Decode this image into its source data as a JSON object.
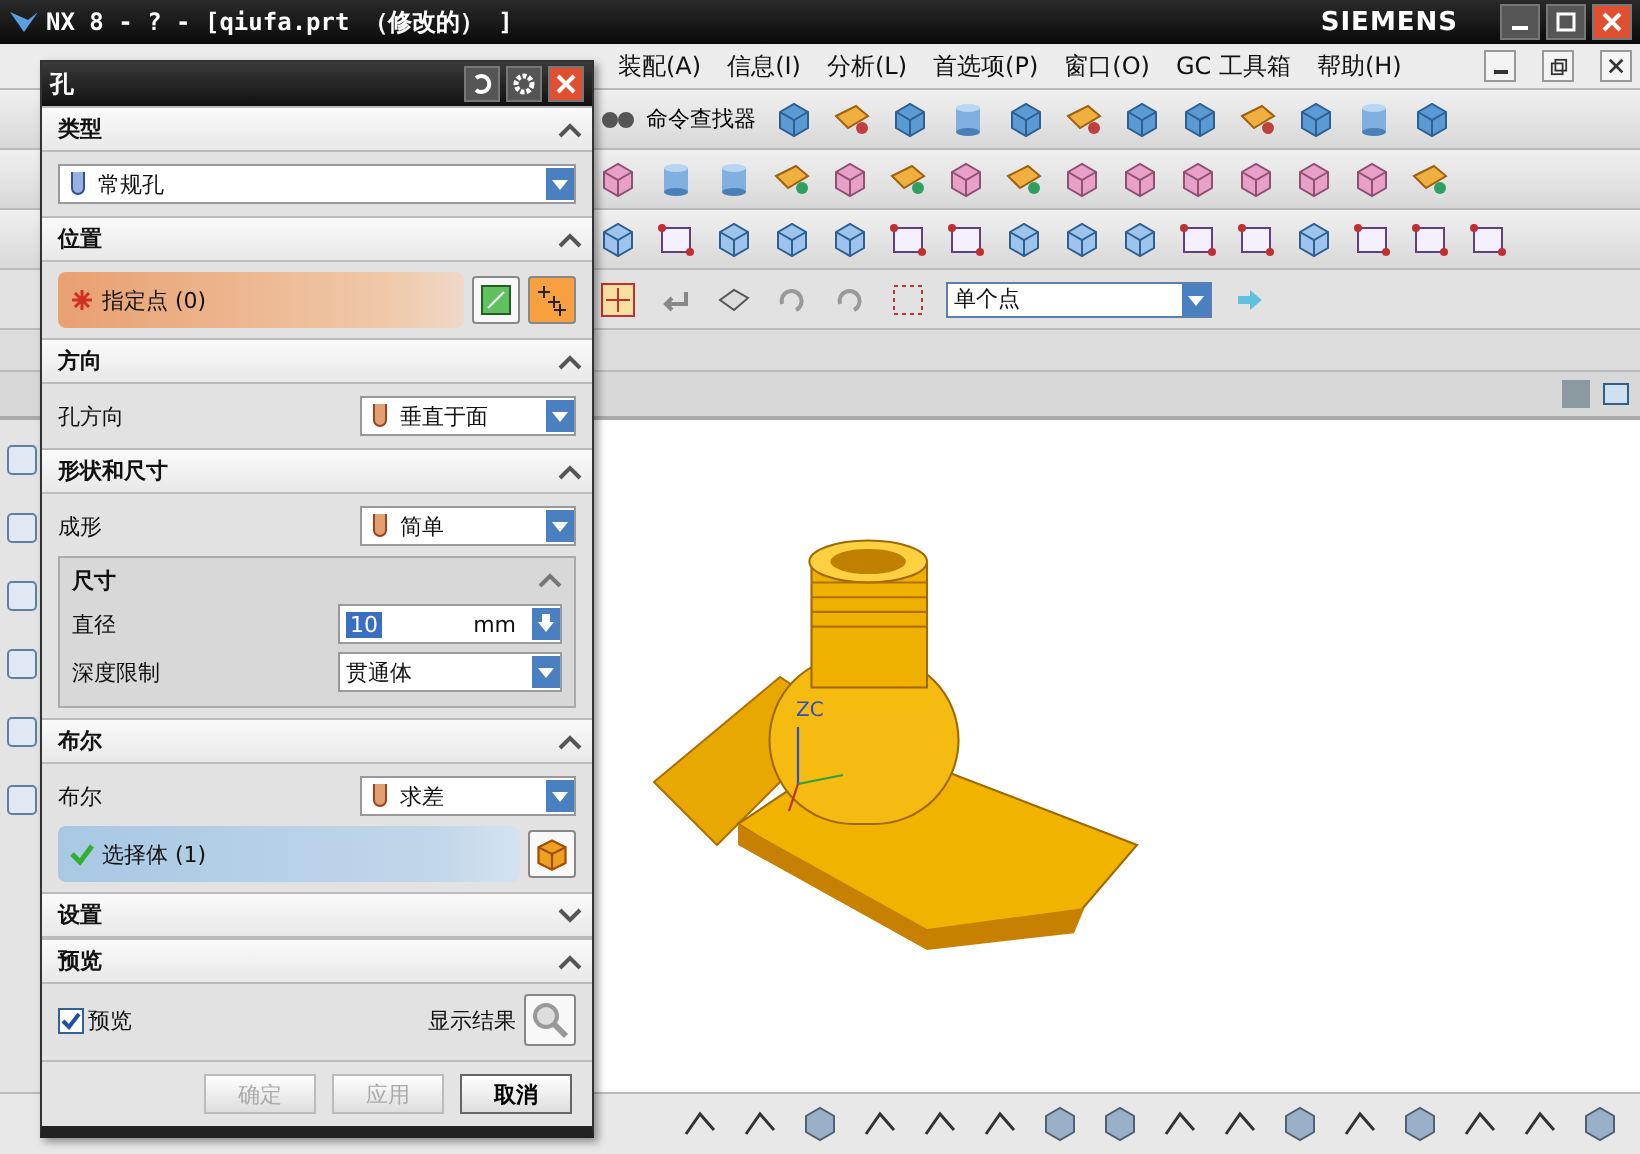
{
  "window": {
    "title": "NX 8 - ? - [qiufa.prt （修改的） ]",
    "brand": "SIEMENS"
  },
  "menu": [
    {
      "label": "装配(A)"
    },
    {
      "label": "信息(I)"
    },
    {
      "label": "分析(L)"
    },
    {
      "label": "首选项(P)"
    },
    {
      "label": "窗口(O)"
    },
    {
      "label": "GC 工具箱"
    },
    {
      "label": "帮助(H)"
    }
  ],
  "toolbar": {
    "command_finder": "命令查找器",
    "selection_filter": "单个点"
  },
  "canvas": {
    "axis_label": "ZC"
  },
  "dialog": {
    "title": "孔",
    "sections": [
      {
        "title": "类型",
        "expanded": true,
        "rows": [
          {
            "kind": "type",
            "value": "常规孔"
          }
        ]
      },
      {
        "title": "位置",
        "expanded": true,
        "rows": [
          {
            "kind": "point-select",
            "prompt": "指定点 (0)",
            "complete": false
          }
        ]
      },
      {
        "title": "方向",
        "expanded": true,
        "rows": [
          {
            "kind": "dropdown",
            "label": "孔方向",
            "value": "垂直于面"
          }
        ]
      },
      {
        "title": "形状和尺寸",
        "expanded": true,
        "rows": [
          {
            "kind": "dropdown",
            "label": "成形",
            "value": "简单"
          },
          {
            "kind": "group",
            "title": "尺寸",
            "expanded": true,
            "rows": [
              {
                "kind": "unit",
                "label": "直径",
                "value": "10",
                "unit": "mm"
              },
              {
                "kind": "dropdown",
                "label": "深度限制",
                "value": "贯通体"
              }
            ]
          }
        ]
      },
      {
        "title": "布尔",
        "expanded": true,
        "rows": [
          {
            "kind": "dropdown",
            "label": "布尔",
            "value": "求差"
          },
          {
            "kind": "body-select",
            "prompt": "选择体 (1)",
            "complete": true
          }
        ]
      },
      {
        "title": "设置",
        "expanded": false
      },
      {
        "title": "预览",
        "expanded": true,
        "rows": [
          {
            "kind": "checkbox",
            "label": "预览",
            "checked": true,
            "result_label": "显示结果"
          }
        ]
      }
    ],
    "buttons": [
      {
        "label": "确定",
        "disabled": true
      },
      {
        "label": "应用",
        "disabled": true
      },
      {
        "label": "取消",
        "disabled": false
      }
    ]
  }
}
